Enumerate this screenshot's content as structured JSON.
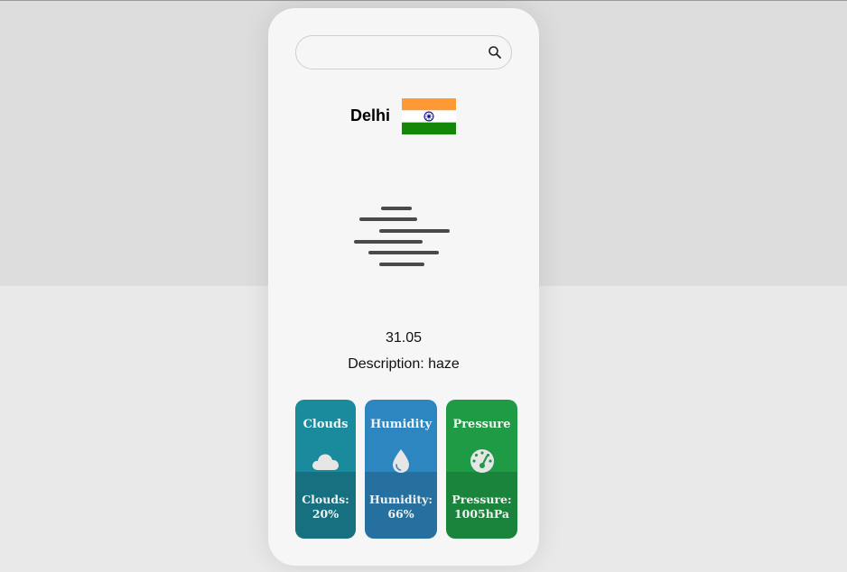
{
  "search": {
    "value": "",
    "placeholder": "",
    "icon": "search-icon"
  },
  "location": {
    "city": "Delhi",
    "flag_icon": "india-flag-icon"
  },
  "weather": {
    "icon": "haze-icon",
    "temperature": "31.05",
    "description": "Description: haze"
  },
  "tiles": {
    "clouds": {
      "title": "Clouds",
      "icon": "cloud-icon",
      "value_label": "Clouds:",
      "value": "20%",
      "color": "#1a8b9c"
    },
    "humidity": {
      "title": "Humidity",
      "icon": "droplet-icon",
      "value_label": "Humidity:",
      "value": "66%",
      "color": "#2e86c1"
    },
    "pressure": {
      "title": "Pressure",
      "icon": "gauge-icon",
      "value_label": "Pressure:",
      "value": "1005hPa",
      "color": "#1f9b46"
    }
  }
}
